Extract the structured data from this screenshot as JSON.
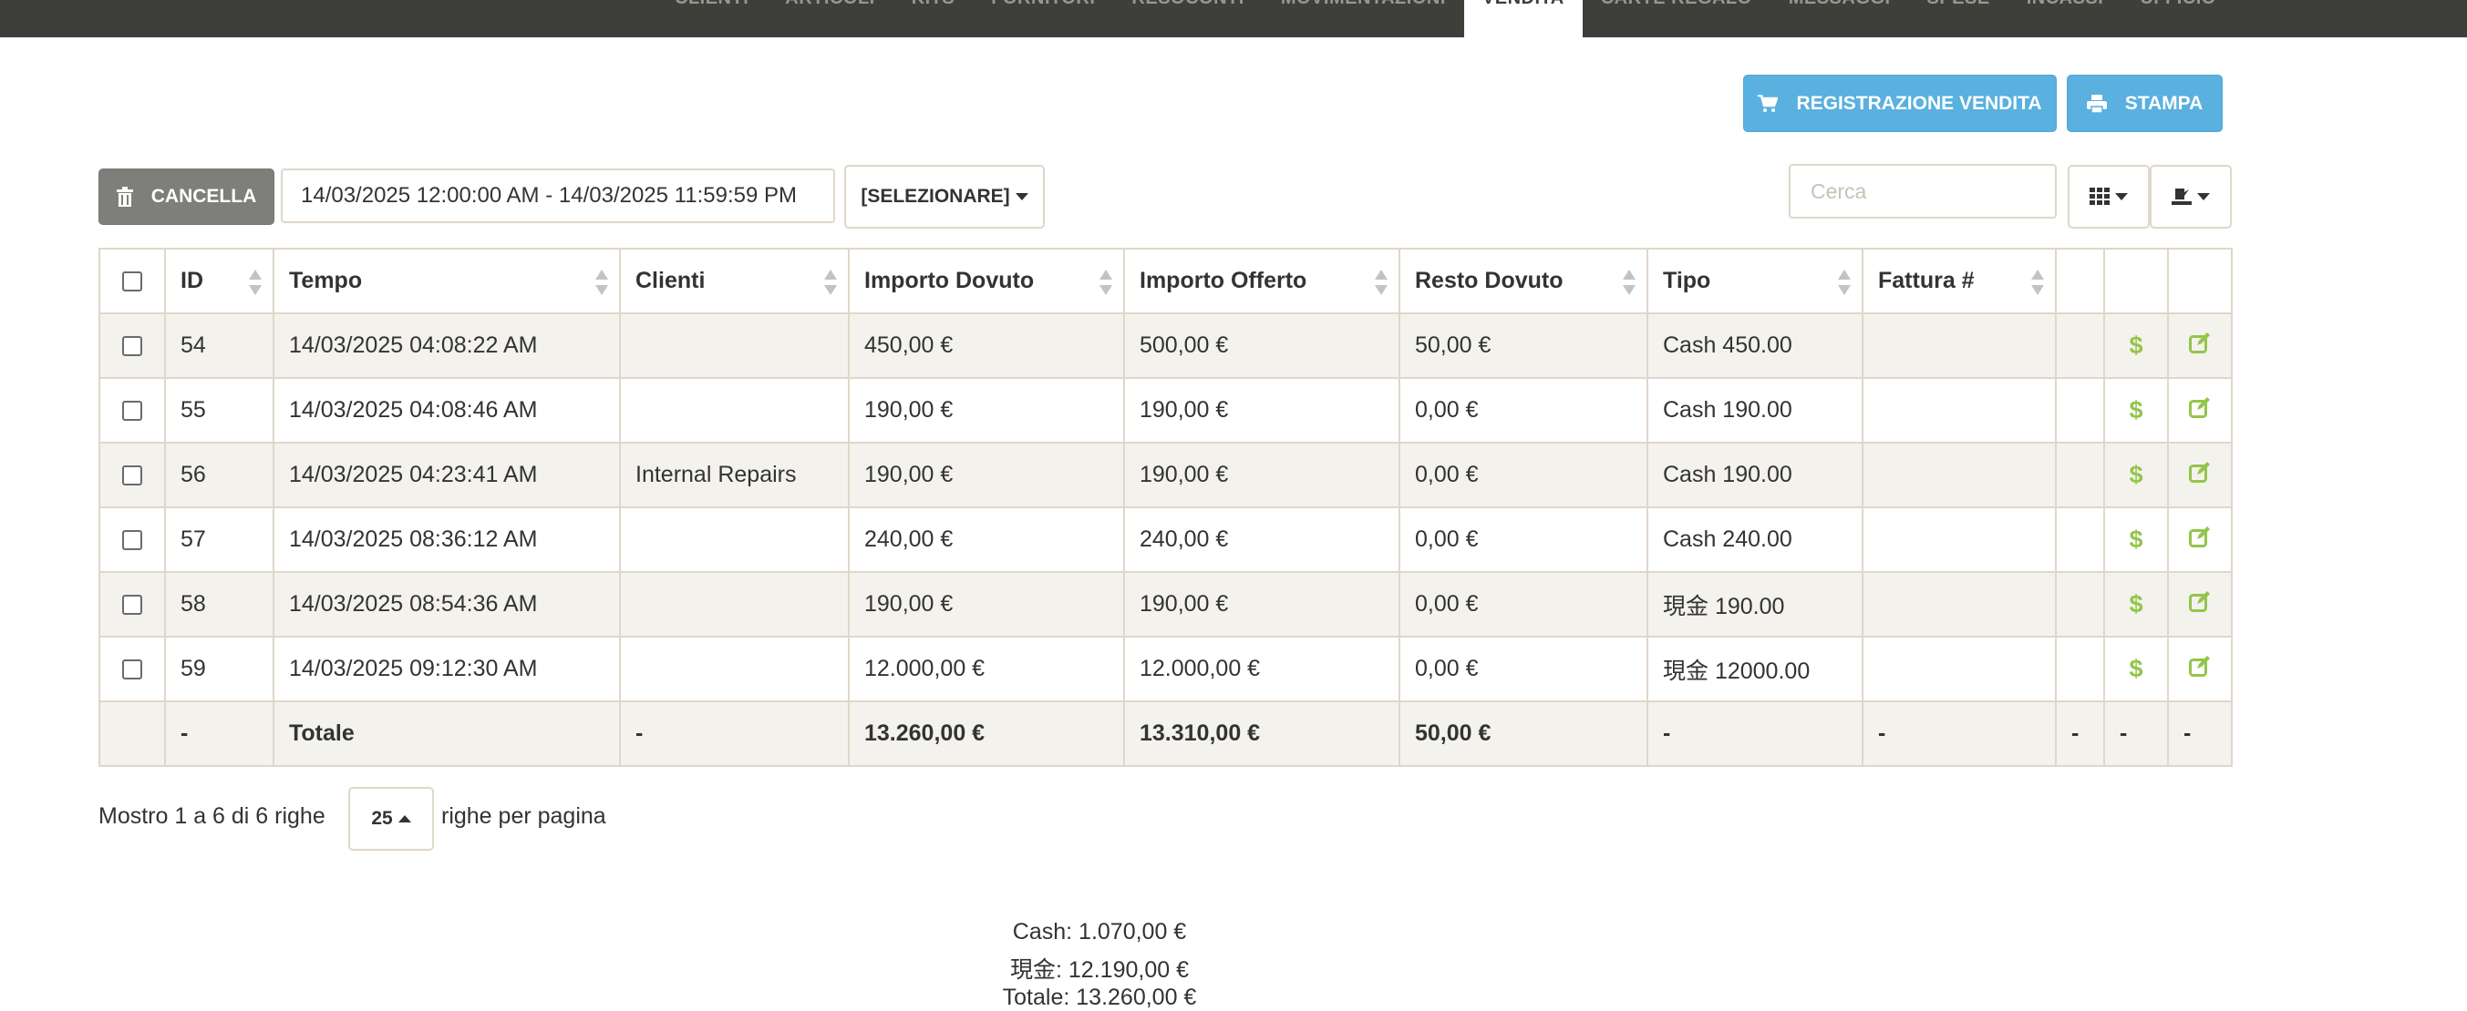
{
  "nav": {
    "items": [
      "CLIENTI",
      "ARTICOLI",
      "KITS",
      "FORNITORI",
      "RESOCONTI",
      "MOVIMENTAZIONI",
      "VENDITA",
      "CARTE REGALO",
      "MESSAGGI",
      "SPESE",
      "INCASSI",
      "UFFICIO"
    ],
    "active": "VENDITA"
  },
  "toolbar": {
    "register_sale_label": "REGISTRAZIONE VENDITA",
    "print_label": "STAMPA",
    "delete_label": "CANCELLA",
    "date_range": "14/03/2025 12:00:00 AM - 14/03/2025 11:59:59 PM",
    "select_label": "[SELEZIONARE]",
    "search_placeholder": "Cerca"
  },
  "table": {
    "columns": [
      "ID",
      "Tempo",
      "Clienti",
      "Importo Dovuto",
      "Importo Offerto",
      "Resto Dovuto",
      "Tipo",
      "Fattura #"
    ],
    "rows": [
      {
        "id": "54",
        "time": "14/03/2025 04:08:22 AM",
        "client": "",
        "due": "450,00 €",
        "offered": "500,00 €",
        "change": "50,00 €",
        "type": "Cash 450.00",
        "invoice": ""
      },
      {
        "id": "55",
        "time": "14/03/2025 04:08:46 AM",
        "client": "",
        "due": "190,00 €",
        "offered": "190,00 €",
        "change": "0,00 €",
        "type": "Cash 190.00",
        "invoice": ""
      },
      {
        "id": "56",
        "time": "14/03/2025 04:23:41 AM",
        "client": "Internal Repairs",
        "due": "190,00 €",
        "offered": "190,00 €",
        "change": "0,00 €",
        "type": "Cash 190.00",
        "invoice": ""
      },
      {
        "id": "57",
        "time": "14/03/2025 08:36:12 AM",
        "client": "",
        "due": "240,00 €",
        "offered": "240,00 €",
        "change": "0,00 €",
        "type": "Cash 240.00",
        "invoice": ""
      },
      {
        "id": "58",
        "time": "14/03/2025 08:54:36 AM",
        "client": "",
        "due": "190,00 €",
        "offered": "190,00 €",
        "change": "0,00 €",
        "type": "現金 190.00",
        "invoice": ""
      },
      {
        "id": "59",
        "time": "14/03/2025 09:12:30 AM",
        "client": "",
        "due": "12.000,00 €",
        "offered": "12.000,00 €",
        "change": "0,00 €",
        "type": "現金 12000.00",
        "invoice": ""
      }
    ],
    "totals": {
      "id": "-",
      "time": "Totale",
      "client": "-",
      "due": "13.260,00 €",
      "offered": "13.310,00 €",
      "change": "50,00 €",
      "type": "-",
      "invoice": "-",
      "extra1": "-",
      "extra2": "-",
      "extra3": "-"
    },
    "action_icons": [
      "dollar-icon",
      "edit-icon"
    ]
  },
  "pagination": {
    "showing": "Mostro 1 a 6 di 6 righe",
    "page_size": "25",
    "per_page_label": "righe per pagina"
  },
  "summary": {
    "cash": "Cash: 1.070,00 €",
    "xianjin": "現金: 12.190,00 €",
    "total": "Totale: 13.260,00 €"
  },
  "colors": {
    "topbar": "#3e3f3a",
    "info": "#5ab0de",
    "gray_button": "#7e7e7a",
    "success_icon": "#93c54b",
    "border": "#dfd7ca",
    "row_stripe": "#f4f2ed"
  }
}
